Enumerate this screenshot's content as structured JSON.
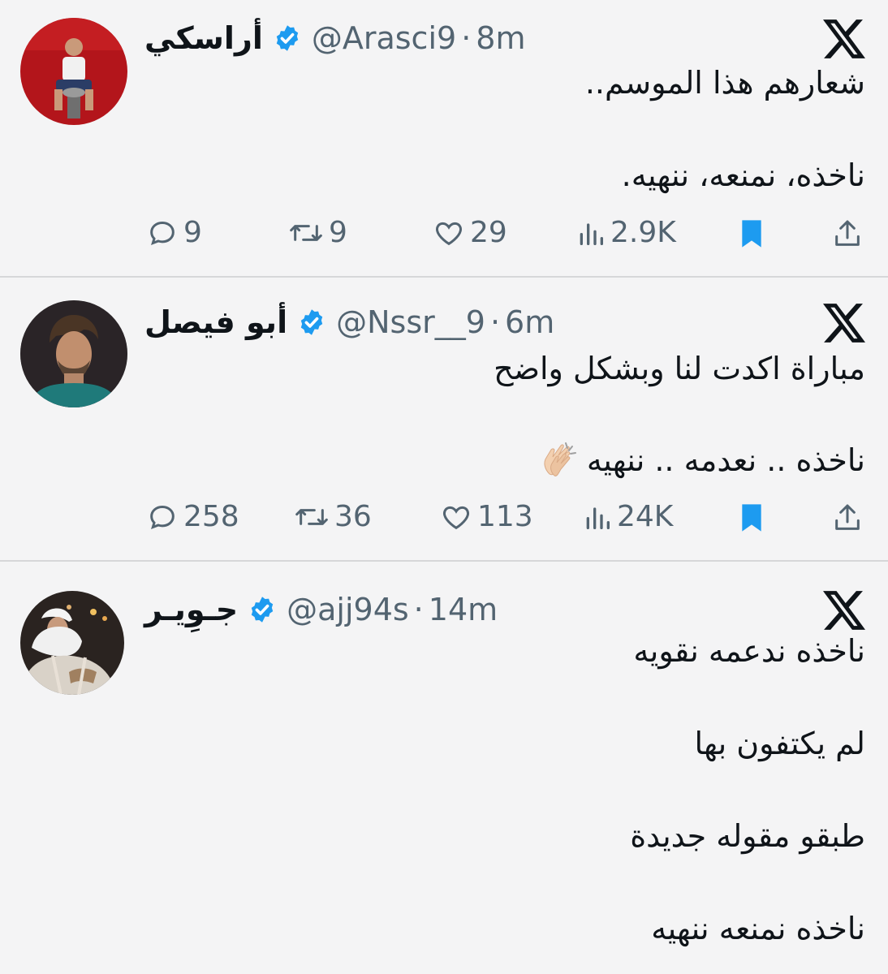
{
  "tweets": [
    {
      "display_name": "أراسكي",
      "handle": "@Arasci9",
      "time": "8m",
      "lines": [
        "شعارهم هذا الموسم..",
        "ناخذه، نمنعه، ننهيه."
      ],
      "stats": {
        "replies": "9",
        "reposts": "9",
        "likes": "29",
        "views": "2.9K"
      }
    },
    {
      "display_name": "أبو فيصل",
      "handle": "@Nssr__9",
      "time": "6m",
      "lines": [
        "مباراة اكدت لنا وبشكل واضح",
        "ناخذه .. نعدمه .. ننهيه"
      ],
      "emoji": "clapping-hands",
      "stats": {
        "replies": "258",
        "reposts": "36",
        "likes": "113",
        "views": "24K"
      }
    },
    {
      "display_name": "جـوِيـر",
      "handle": "@ajj94s",
      "time": "14m",
      "lines": [
        "ناخذه ندعمه نقويه",
        "لم يكتفون بها",
        "طبقو مقوله جديدة",
        "ناخذه نمنعه ننهيه"
      ]
    }
  ],
  "separator": "·",
  "colors": {
    "verified": "#1d9bf0",
    "bookmark": "#1d9bf0",
    "muted": "#536471",
    "background": "#f4f4f5"
  },
  "icons": [
    "x-logo-icon",
    "verified-badge-icon",
    "reply-icon",
    "repost-icon",
    "like-icon",
    "views-icon",
    "bookmark-icon",
    "share-icon"
  ]
}
